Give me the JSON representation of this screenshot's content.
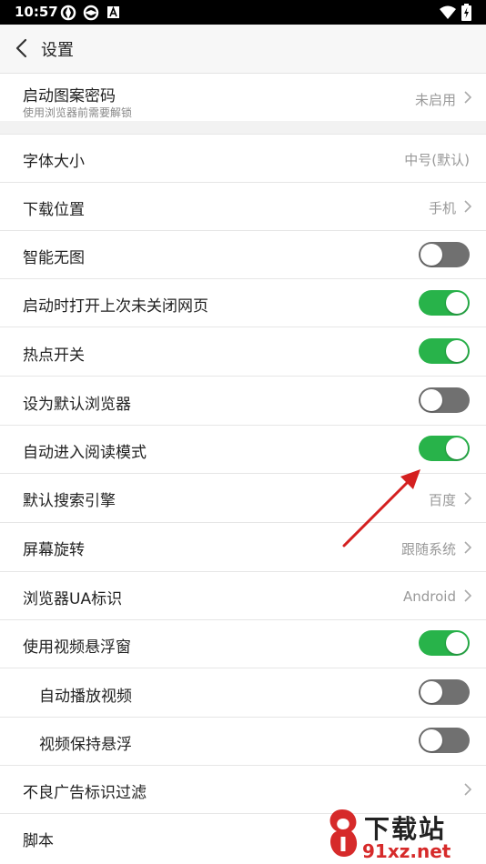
{
  "status_bar": {
    "time": "10:57"
  },
  "header": {
    "title": "设置"
  },
  "settings": {
    "pattern_password": {
      "label": "启动图案密码",
      "sublabel": "使用浏览器前需要解锁",
      "value": "未启用"
    },
    "font_size": {
      "label": "字体大小",
      "value": "中号(默认)"
    },
    "download_location": {
      "label": "下载位置",
      "value": "手机"
    },
    "smart_no_image": {
      "label": "智能无图",
      "enabled": false
    },
    "restore_tabs": {
      "label": "启动时打开上次未关闭网页",
      "enabled": true
    },
    "hotspot": {
      "label": "热点开关",
      "enabled": true
    },
    "default_browser": {
      "label": "设为默认浏览器",
      "enabled": false
    },
    "auto_reader": {
      "label": "自动进入阅读模式",
      "enabled": true
    },
    "search_engine": {
      "label": "默认搜索引擎",
      "value": "百度"
    },
    "rotation": {
      "label": "屏幕旋转",
      "value": "跟随系统"
    },
    "ua": {
      "label": "浏览器UA标识",
      "value": "Android"
    },
    "floating_video": {
      "label": "使用视频悬浮窗",
      "enabled": true
    },
    "autoplay_video": {
      "label": "自动播放视频",
      "enabled": false
    },
    "keep_floating": {
      "label": "视频保持悬浮",
      "enabled": false
    },
    "ad_filter": {
      "label": "不良广告标识过滤"
    },
    "script": {
      "label": "脚本"
    }
  },
  "watermark": {
    "title": "下载站",
    "url": "91xz.net"
  },
  "colors": {
    "toggle_on": "#28b34a",
    "toggle_off": "#707070",
    "annotation_arrow": "#d42020"
  }
}
